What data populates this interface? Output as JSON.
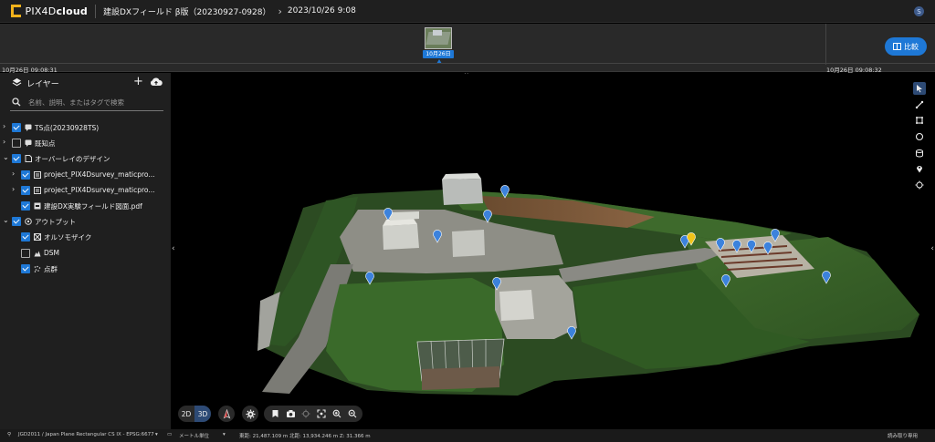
{
  "header": {
    "brand_light": "PIX4D",
    "brand_bold": "cloud",
    "project_name": "建設DXフィールド β版（20230927-0928）",
    "datetime": "2023/10/26 9:08",
    "user_initial": "S"
  },
  "timeline": {
    "thumb_label": "10月26日",
    "start_time": "10月26日 09:08:31",
    "end_time": "10月26日 09:08:32",
    "compare_label": "比較"
  },
  "sidebar": {
    "title": "レイヤー",
    "search_placeholder": "名前、説明、またはタグで検索",
    "rows": [
      {
        "label": "TS点(20230928TS)",
        "checked": true,
        "expandable": true,
        "indent": 0,
        "icon": "comment-icon"
      },
      {
        "label": "既知点",
        "checked": false,
        "expandable": true,
        "indent": 0,
        "icon": "comment-icon"
      },
      {
        "label": "オーバーレイのデザイン",
        "checked": true,
        "expandable": true,
        "expanded": true,
        "indent": 0,
        "icon": "document-icon"
      },
      {
        "label": "project_PIX4Dsurvey_maticpro...",
        "checked": true,
        "expandable": true,
        "indent": 1,
        "icon": "drawing-icon"
      },
      {
        "label": "project_PIX4Dsurvey_maticpro...",
        "checked": true,
        "expandable": true,
        "indent": 1,
        "icon": "drawing-icon"
      },
      {
        "label": "建設DX実験フィールド図面.pdf",
        "checked": true,
        "expandable": false,
        "indent": 1,
        "icon": "pdf-icon"
      },
      {
        "label": "アウトプット",
        "checked": true,
        "expandable": true,
        "expanded": true,
        "indent": 0,
        "icon": "output-icon"
      },
      {
        "label": "オルソモザイク",
        "checked": true,
        "expandable": false,
        "indent": 1,
        "icon": "orthomosaic-icon"
      },
      {
        "label": "DSM",
        "checked": false,
        "expandable": false,
        "indent": 1,
        "icon": "dsm-icon"
      },
      {
        "label": "点群",
        "checked": true,
        "expandable": false,
        "indent": 1,
        "icon": "point-cloud-icon"
      }
    ]
  },
  "viewport": {
    "view_2d": "2D",
    "view_3d": "3D",
    "active_view": "3D",
    "markers": [
      {
        "color": "#3c82dc"
      },
      {
        "color": "#3c82dc"
      },
      {
        "color": "#3c82dc"
      },
      {
        "color": "#3c82dc"
      },
      {
        "color": "#3c82dc"
      },
      {
        "color": "#3c82dc"
      },
      {
        "color": "#3c82dc"
      },
      {
        "color": "#3c82dc"
      },
      {
        "color": "#3c82dc"
      },
      {
        "color": "#3c82dc"
      },
      {
        "color": "#3c82dc"
      },
      {
        "color": "#3c82dc"
      },
      {
        "color": "#3c82dc"
      },
      {
        "color": "#3c82dc"
      },
      {
        "color": "#3c82dc"
      },
      {
        "color": "#f0c419"
      }
    ]
  },
  "statusbar": {
    "crs": "JGD2011 / Japan Plane Rectangular CS IX - EPSG:6677",
    "units": "メートル単位",
    "coords": "東距: 21,487.109 m  北距: 13,934.246 m  Z: 31.366 m",
    "mode": "読み取り専用"
  },
  "colors": {
    "accent": "#1e78d6",
    "panel": "#1f1f1f",
    "background": "#000000"
  }
}
